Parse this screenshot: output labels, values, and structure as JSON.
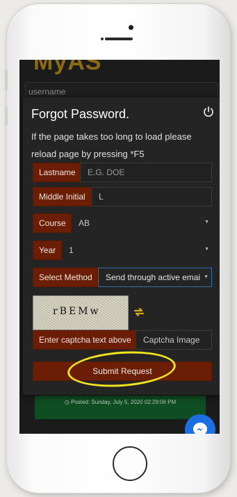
{
  "app": {
    "logo_text": "MyAS",
    "username_placeholder": "username"
  },
  "modal": {
    "title": "Forgot Password.",
    "message": "If the page takes too long to load please reload page by pressing *F5"
  },
  "form": {
    "lastname_label": "Lastname",
    "lastname_value": "E.G. DOE",
    "middle_initial_label": "Middle Initial",
    "middle_initial_value": "L",
    "course_label": "Course",
    "course_value": "AB",
    "year_label": "Year",
    "year_value": "1",
    "method_label": "Select Method",
    "method_value": "Send through active emai",
    "captcha_label": "Enter captcha text above",
    "captcha_placeholder": "Captcha Image",
    "captcha_image_text": "rBEMw",
    "submit_label": "Submit Request"
  },
  "background": {
    "posted_text": "Posted: Sunday, July 5, 2020 02:29:06 PM"
  },
  "colors": {
    "accent": "#6b1e05",
    "highlight": "#f1e31e",
    "refresh_icon": "#d8a915",
    "posted_bg": "#0f4d22",
    "messenger": "#1c6fe0"
  },
  "icons": [
    "power-icon",
    "refresh-icon",
    "chevron-down-icon",
    "clock-icon",
    "messenger-icon"
  ]
}
